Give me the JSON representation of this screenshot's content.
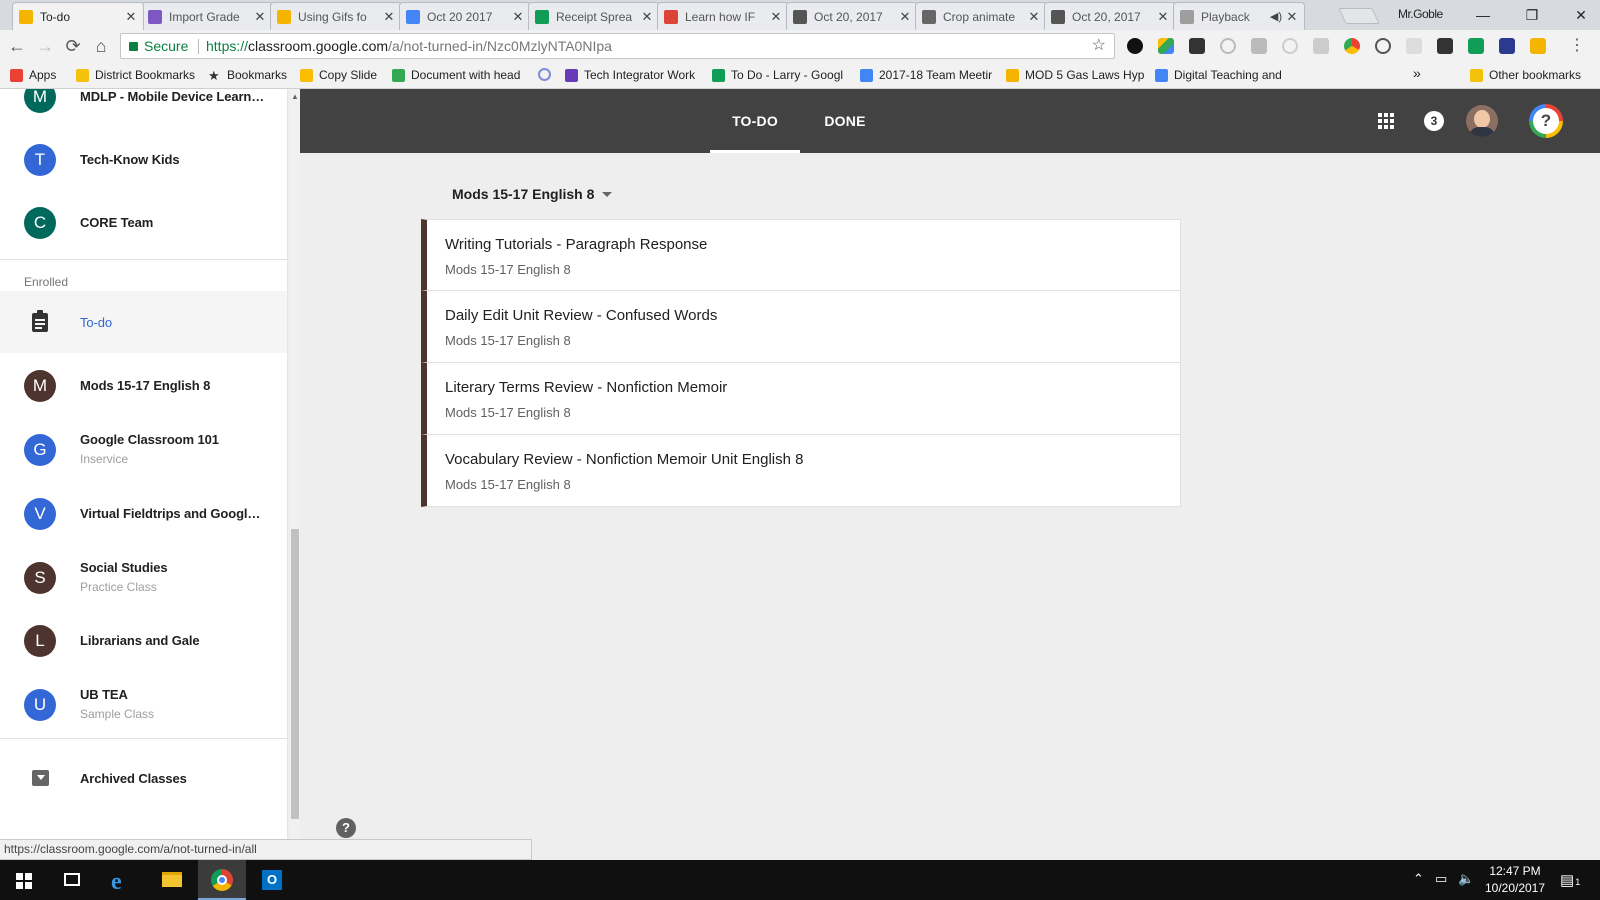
{
  "browser": {
    "tabs": [
      {
        "title": "To-do",
        "color": "#f4b400",
        "active": true
      },
      {
        "title": "Import Grade",
        "color": "#7e57c2"
      },
      {
        "title": "Using Gifs fo",
        "color": "#f4b400"
      },
      {
        "title": "Oct 20 2017",
        "color": "#4285f4"
      },
      {
        "title": "Receipt Sprea",
        "color": "#0f9d58"
      },
      {
        "title": "Learn how IF",
        "color": "#db4437"
      },
      {
        "title": "Oct 20, 2017",
        "color": "#555555"
      },
      {
        "title": "Crop animate",
        "color": "#666666"
      },
      {
        "title": "Oct 20, 2017",
        "color": "#555555"
      },
      {
        "title": "Playback",
        "color": "#9e9e9e",
        "audio_icon": "speaker-icon"
      }
    ],
    "profile_name": "Mr.Goble",
    "window_controls": {
      "minimize": "—",
      "restore": "❐",
      "close": "✕"
    },
    "nav": {
      "back": "←",
      "forward": "→",
      "reload": "⟳",
      "home": "⌂"
    },
    "omnibox": {
      "secure_label": "Secure",
      "url_scheme": "https://",
      "url_host": "classroom.google.com",
      "url_path": "/a/not-turned-in/Nzc0MzlyNTA0NIpa"
    },
    "bookmarks": [
      {
        "label": "Apps",
        "icon": "apps-grid-icon",
        "color": "#ea4335"
      },
      {
        "label": "District Bookmarks",
        "icon": "folder-icon",
        "color": "#f4c20d"
      },
      {
        "label": "Bookmarks",
        "icon": "star-icon",
        "color": "#333333"
      },
      {
        "label": "Copy Slide",
        "icon": "drive-icon",
        "color": "#fbbc04"
      },
      {
        "label": "Document with head",
        "icon": "drive-icon",
        "color": "#34a853"
      },
      {
        "label": "",
        "icon": "link-icon",
        "color": "#7e8dd6"
      },
      {
        "label": "Tech Integrator Work",
        "icon": "forms-icon",
        "color": "#673ab7"
      },
      {
        "label": "To Do - Larry - Googl",
        "icon": "sheets-icon",
        "color": "#0f9d58"
      },
      {
        "label": "2017-18 Team Meetir",
        "icon": "docs-icon",
        "color": "#4285f4"
      },
      {
        "label": "MOD 5 Gas Laws Hyp",
        "icon": "slides-icon",
        "color": "#f4b400"
      },
      {
        "label": "Digital Teaching and",
        "icon": "drive-icon",
        "color": "#4285f4"
      }
    ],
    "bookmarks_overflow": "»",
    "other_bookmarks": "Other bookmarks"
  },
  "sidebar": {
    "teaching_classes": [
      {
        "letter": "M",
        "name": "MDLP - Mobile Device Learni...",
        "color": "#00695c"
      },
      {
        "letter": "T",
        "name": "Tech-Know Kids",
        "color": "#3367d6"
      },
      {
        "letter": "C",
        "name": "CORE Team",
        "color": "#00695c"
      }
    ],
    "enrolled_label": "Enrolled",
    "todo_label": "To-do",
    "enrolled_classes": [
      {
        "letter": "M",
        "name": "Mods 15-17 English 8",
        "section": "",
        "color": "#4e342e"
      },
      {
        "letter": "G",
        "name": "Google Classroom 101",
        "section": "Inservice",
        "color": "#3367d6"
      },
      {
        "letter": "V",
        "name": "Virtual Fieldtrips and Google ...",
        "section": "",
        "color": "#3367d6"
      },
      {
        "letter": "S",
        "name": "Social Studies",
        "section": "Practice Class",
        "color": "#4e342e"
      },
      {
        "letter": "L",
        "name": "Librarians and Gale",
        "section": "",
        "color": "#4e342e"
      },
      {
        "letter": "U",
        "name": "UB TEA",
        "section": "Sample Class",
        "color": "#3367d6"
      }
    ],
    "archived_label": "Archived Classes"
  },
  "appbar": {
    "tabs": [
      {
        "label": "TO-DO",
        "active": true
      },
      {
        "label": "DONE",
        "active": false
      }
    ],
    "notification_count": "3",
    "help_symbol": "?"
  },
  "main": {
    "class_filter": "Mods 15-17 English 8",
    "todo_items": [
      {
        "title": "Writing Tutorials - Paragraph Response",
        "class": "Mods 15-17 English 8"
      },
      {
        "title": "Daily Edit Unit Review - Confused Words",
        "class": "Mods 15-17 English 8"
      },
      {
        "title": "Literary Terms Review - Nonfiction Memoir",
        "class": "Mods 15-17 English 8"
      },
      {
        "title": "Vocabulary Review - Nonfiction Memoir Unit English 8",
        "class": "Mods 15-17 English 8"
      }
    ],
    "accent_color": "#4e342e",
    "bottom_help": "?"
  },
  "status_bar": {
    "url": "https://classroom.google.com/a/not-turned-in/all"
  },
  "taskbar": {
    "time": "12:47 PM",
    "date": "10/20/2017",
    "notification_badge": "1",
    "apps": [
      "start-icon",
      "task-view-icon",
      "edge-icon",
      "file-explorer-icon",
      "chrome-icon",
      "outlook-icon"
    ]
  }
}
